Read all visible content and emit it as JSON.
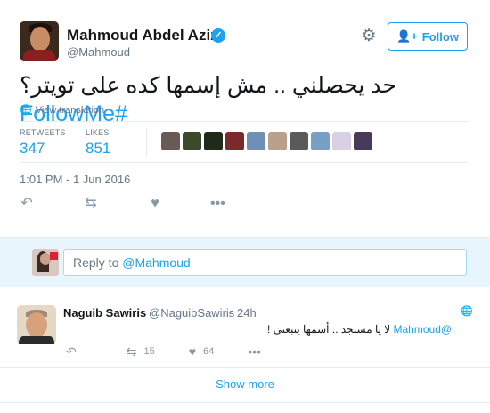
{
  "tweet": {
    "author_name": "Mahmoud Abdel Aziz",
    "author_handle": "@Mahmoud",
    "verified_mark": "✓",
    "follow_label": "Follow",
    "text_arabic": "حد يحصلني .. مش إسمها كده على تويتر؟",
    "hashtag": "#FollowMe",
    "view_translation": "View translation",
    "stats": {
      "retweets_label": "RETWEETS",
      "retweets_count": "347",
      "likes_label": "LIKES",
      "likes_count": "851"
    },
    "likers_colors": [
      "#6a5a56",
      "#3a4a2a",
      "#1f2a1a",
      "#7a2a2a",
      "#6f8fb5",
      "#b9a08a",
      "#5a5a5a",
      "#7a9fc5",
      "#d9d0e6",
      "#4a3a5a"
    ],
    "timestamp": "1:01 PM - 1 Jun 2016",
    "icons": [
      "reply-icon",
      "retweet-icon",
      "like-icon",
      "more-icon"
    ]
  },
  "reply_box": {
    "prefix": "Reply to ",
    "mention": "@Mahmoud"
  },
  "reply": {
    "author_name": "Naguib Sawiris",
    "author_handle": "@NaguibSawiris",
    "separator": "·",
    "time": "24h",
    "mention": "@Mahmoud",
    "text_line1": "لا يا مستجد .. أسمها يتبعنى !",
    "retweet_count": "15",
    "like_count": "64"
  },
  "show_more_label": "Show more",
  "colors": {
    "accent": "#1da1f2",
    "muted": "#657786",
    "reply_bg": "#e8f5fd"
  }
}
